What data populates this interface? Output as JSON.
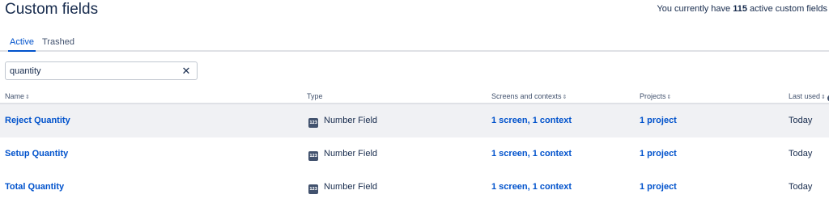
{
  "header": {
    "title": "Custom fields",
    "summary_prefix": "You currently have ",
    "summary_count": "115",
    "summary_suffix": " active custom fields"
  },
  "tabs": [
    {
      "label": "Active",
      "active": true
    },
    {
      "label": "Trashed",
      "active": false
    }
  ],
  "search": {
    "value": "quantity",
    "clear_label": "✕"
  },
  "table": {
    "columns": {
      "name": "Name",
      "type": "Type",
      "screens": "Screens and contexts",
      "projects": "Projects",
      "last_used": "Last used",
      "sort_glyph": "⇕",
      "help_glyph": "?"
    },
    "type_icon_text": "123",
    "rows": [
      {
        "name": "Reject Quantity",
        "type": "Number Field",
        "screens": "1 screen, 1 context",
        "projects": "1 project",
        "last_used": "Today"
      },
      {
        "name": "Setup Quantity",
        "type": "Number Field",
        "screens": "1 screen, 1 context",
        "projects": "1 project",
        "last_used": "Today"
      },
      {
        "name": "Total Quantity",
        "type": "Number Field",
        "screens": "1 screen, 1 context",
        "projects": "1 project",
        "last_used": "Today"
      }
    ]
  },
  "colors": {
    "link": "#0052cc",
    "text": "#172b4d",
    "highlight_row": "#f0f1f4"
  }
}
